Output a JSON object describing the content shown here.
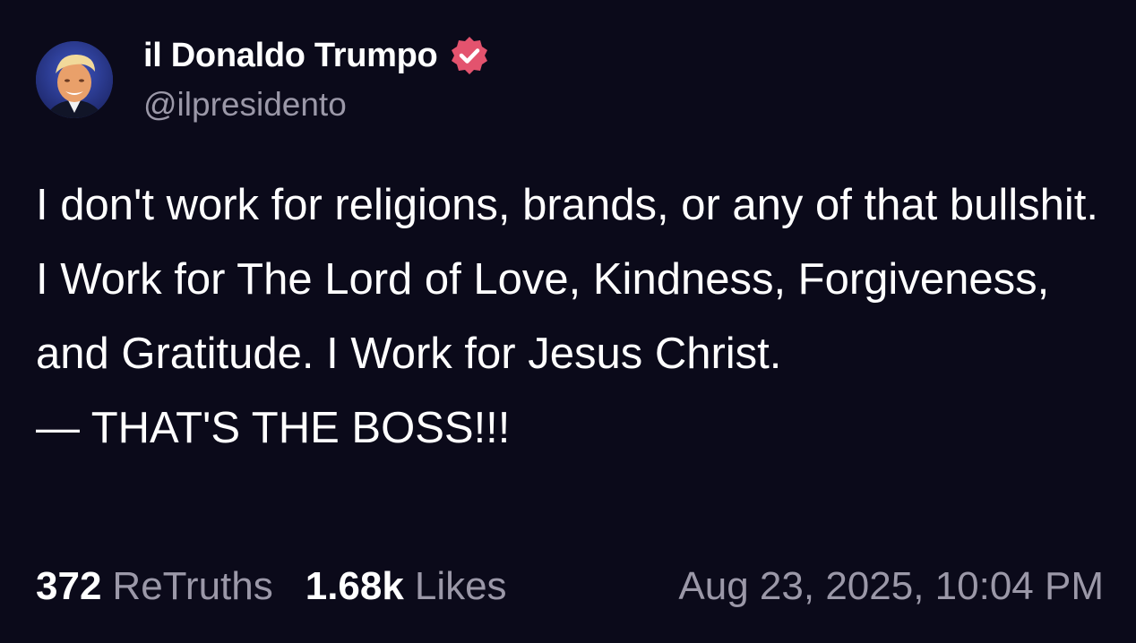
{
  "post": {
    "author": {
      "display_name": "il Donaldo Trumpo",
      "handle": "@ilpresidento",
      "verified_icon": "verified-badge-icon",
      "avatar_icon": "avatar"
    },
    "body": {
      "paragraph": "I don't work for religions, brands, or any of that bullshit. I Work for The Lord of Love, Kindness, Forgiveness, and Gratitude. I Work for Jesus Christ.",
      "closing_line": "— THAT'S THE BOSS!!!"
    },
    "stats": {
      "retruths_count": "372",
      "retruths_label": "ReTruths",
      "likes_count": "1.68k",
      "likes_label": "Likes"
    },
    "timestamp": "Aug 23, 2025, 10:04 PM"
  },
  "colors": {
    "background": "#0b0a1a",
    "text_primary": "#ffffff",
    "text_secondary": "#9b98a8",
    "verified_badge": "#e3536e"
  }
}
